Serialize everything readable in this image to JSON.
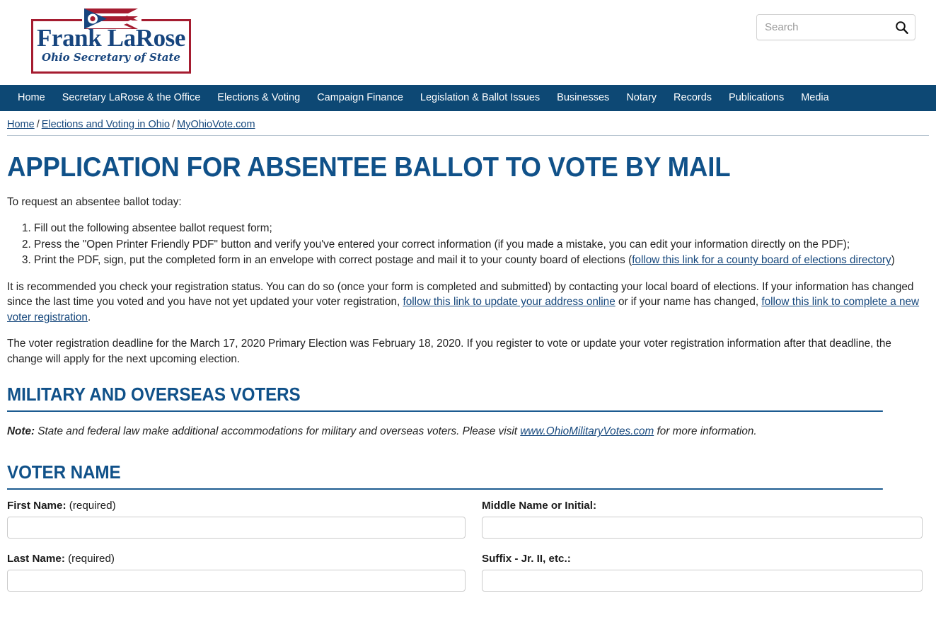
{
  "header": {
    "logo": {
      "name": "Frank LaRose",
      "subtitle": "Ohio Secretary of State",
      "flag_icon": "ohio-flag-icon"
    },
    "search": {
      "placeholder": "Search",
      "value": "",
      "button_icon": "search-icon"
    }
  },
  "nav": {
    "items": [
      {
        "label": "Home"
      },
      {
        "label": "Secretary LaRose & the Office"
      },
      {
        "label": "Elections & Voting"
      },
      {
        "label": "Campaign Finance"
      },
      {
        "label": "Legislation & Ballot Issues"
      },
      {
        "label": "Businesses"
      },
      {
        "label": "Notary"
      },
      {
        "label": "Records"
      },
      {
        "label": "Publications"
      },
      {
        "label": "Media"
      }
    ]
  },
  "breadcrumb": {
    "items": [
      {
        "label": "Home"
      },
      {
        "label": "Elections and Voting in Ohio"
      },
      {
        "label": "MyOhioVote.com"
      }
    ],
    "separator": "/"
  },
  "main": {
    "title": "APPLICATION FOR ABSENTEE BALLOT TO VOTE BY MAIL",
    "intro": "To request an absentee ballot today:",
    "steps": [
      {
        "text": "Fill out the following absentee ballot request form;"
      },
      {
        "text": "Press the \"Open Printer Friendly PDF\" button and verify you've entered your correct information (if you made a mistake, you can edit your information directly on the PDF);"
      },
      {
        "text_before": "Print the PDF, sign, put the completed form in an envelope with correct postage and mail it to your county board of elections (",
        "link": "follow this link for a county board of elections directory",
        "text_after": ")"
      }
    ],
    "registration_paragraph": {
      "part1": "It is recommended you check your registration status. You can do so (once your form is completed and submitted) by contacting your local board of elections. If your information has changed since the last time you voted and you have not yet updated your voter registration, ",
      "link1": "follow this link to update your address online",
      "part2": " or if your name has changed, ",
      "link2": "follow this link to complete a new voter registration",
      "part3": "."
    },
    "deadline_paragraph": "The voter registration deadline for the March 17, 2020 Primary Election was February 18, 2020. If you register to vote or update your voter registration information after that deadline, the change will apply for the next upcoming election.",
    "military_section": {
      "heading": "MILITARY AND OVERSEAS VOTERS",
      "note_label": "Note:",
      "note_text_before": " State and federal law make additional accommodations for military and overseas voters. Please visit ",
      "note_link": "www.OhioMilitaryVotes.com",
      "note_text_after": " for more information."
    },
    "voter_name_section": {
      "heading": "VOTER NAME",
      "fields": {
        "first_name": {
          "label": "First Name:",
          "required_text": "(required)",
          "value": ""
        },
        "middle_name": {
          "label": "Middle Name or Initial:",
          "required_text": "",
          "value": ""
        },
        "last_name": {
          "label": "Last Name:",
          "required_text": "(required)",
          "value": ""
        },
        "suffix": {
          "label": "Suffix - Jr. II, etc.:",
          "required_text": "",
          "value": ""
        }
      }
    }
  },
  "colors": {
    "nav_navy": "#0d4874",
    "heading_navy": "#105189",
    "link_navy": "#15477c",
    "logo_red": "#a51c30",
    "logo_navy": "#17457e"
  }
}
